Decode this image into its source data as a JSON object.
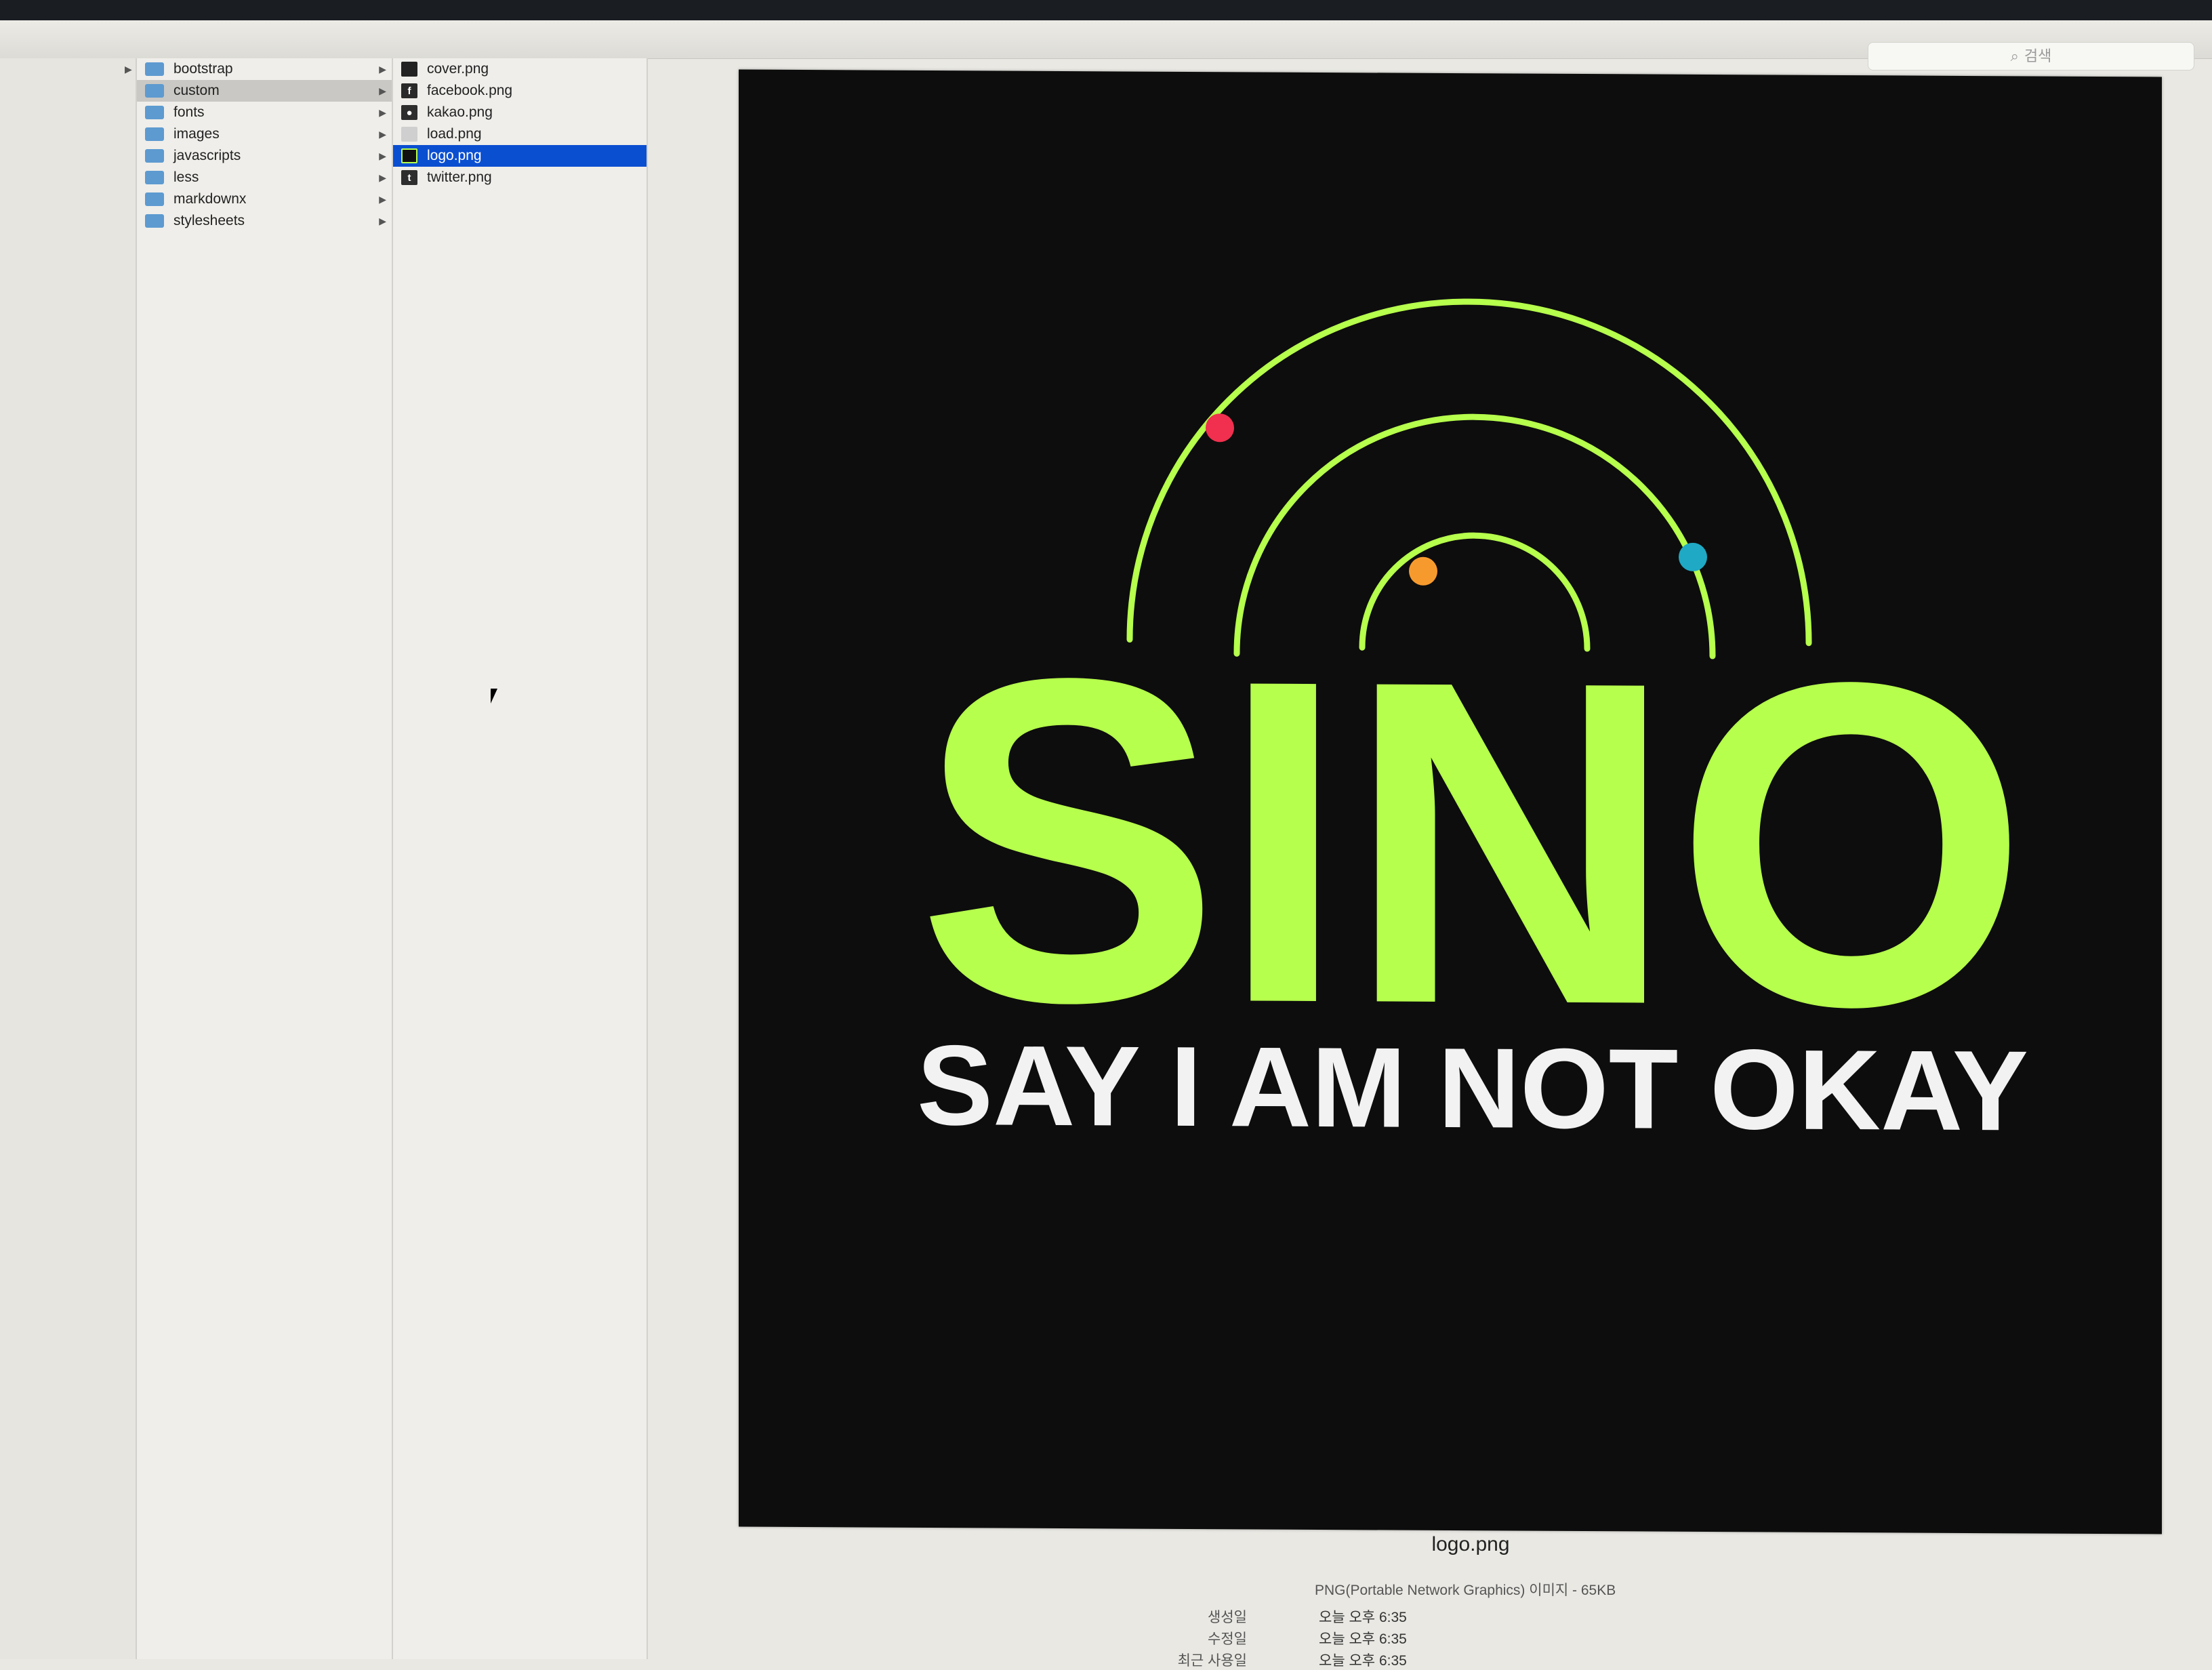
{
  "window": {
    "search_placeholder": "검색",
    "search_icon": "magnifier-icon"
  },
  "sidebar_column": {
    "arrow": "▶"
  },
  "folders": [
    {
      "label": "bootstrap",
      "selected": false
    },
    {
      "label": "custom",
      "selected": true
    },
    {
      "label": "fonts",
      "selected": false
    },
    {
      "label": "images",
      "selected": false
    },
    {
      "label": "javascripts",
      "selected": false
    },
    {
      "label": "less",
      "selected": false
    },
    {
      "label": "markdownx",
      "selected": false
    },
    {
      "label": "stylesheets",
      "selected": false
    }
  ],
  "files": [
    {
      "label": "cover.png",
      "icon": "image-file-icon",
      "selected": false
    },
    {
      "label": "facebook.png",
      "icon": "facebook-icon",
      "selected": false
    },
    {
      "label": "kakao.png",
      "icon": "kakao-icon",
      "selected": false
    },
    {
      "label": "load.png",
      "icon": "image-file-icon",
      "selected": false
    },
    {
      "label": "logo.png",
      "icon": "image-file-icon",
      "selected": true
    },
    {
      "label": "twitter.png",
      "icon": "twitter-icon",
      "selected": false
    }
  ],
  "preview": {
    "logo_word": "SINO",
    "tagline": "SAY I AM NOT OKAY",
    "colors": {
      "background": "#0d0d0d",
      "green": "#b6ff4c",
      "white": "#f2f2f2",
      "dot_red": "#f0304e",
      "dot_orange": "#f79a2e",
      "dot_teal": "#1fa9c4"
    },
    "filename": "logo.png",
    "kind": "PNG(Portable Network Graphics) 이미지 - 65KB",
    "info": [
      {
        "label": "생성일",
        "value": "오늘 오후 6:35"
      },
      {
        "label": "수정일",
        "value": "오늘 오후 6:35"
      },
      {
        "label": "최근 사용일",
        "value": "오늘 오후 6:35"
      }
    ]
  }
}
